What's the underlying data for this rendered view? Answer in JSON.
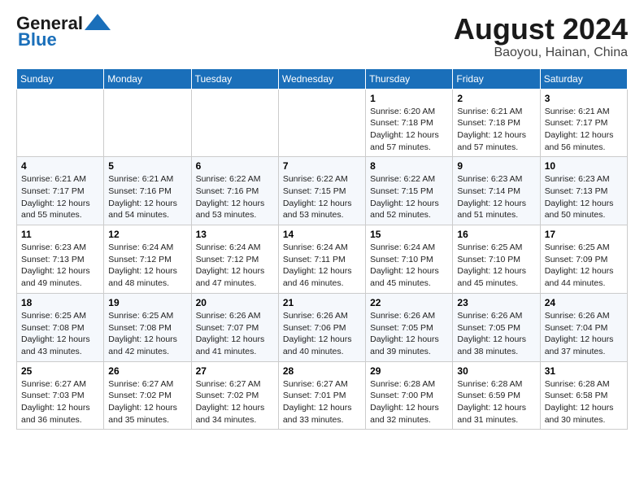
{
  "header": {
    "logo_line1": "General",
    "logo_line2": "Blue",
    "month": "August 2024",
    "location": "Baoyou, Hainan, China"
  },
  "weekdays": [
    "Sunday",
    "Monday",
    "Tuesday",
    "Wednesday",
    "Thursday",
    "Friday",
    "Saturday"
  ],
  "weeks": [
    [
      {
        "day": "",
        "info": ""
      },
      {
        "day": "",
        "info": ""
      },
      {
        "day": "",
        "info": ""
      },
      {
        "day": "",
        "info": ""
      },
      {
        "day": "1",
        "info": "Sunrise: 6:20 AM\nSunset: 7:18 PM\nDaylight: 12 hours\nand 57 minutes."
      },
      {
        "day": "2",
        "info": "Sunrise: 6:21 AM\nSunset: 7:18 PM\nDaylight: 12 hours\nand 57 minutes."
      },
      {
        "day": "3",
        "info": "Sunrise: 6:21 AM\nSunset: 7:17 PM\nDaylight: 12 hours\nand 56 minutes."
      }
    ],
    [
      {
        "day": "4",
        "info": "Sunrise: 6:21 AM\nSunset: 7:17 PM\nDaylight: 12 hours\nand 55 minutes."
      },
      {
        "day": "5",
        "info": "Sunrise: 6:21 AM\nSunset: 7:16 PM\nDaylight: 12 hours\nand 54 minutes."
      },
      {
        "day": "6",
        "info": "Sunrise: 6:22 AM\nSunset: 7:16 PM\nDaylight: 12 hours\nand 53 minutes."
      },
      {
        "day": "7",
        "info": "Sunrise: 6:22 AM\nSunset: 7:15 PM\nDaylight: 12 hours\nand 53 minutes."
      },
      {
        "day": "8",
        "info": "Sunrise: 6:22 AM\nSunset: 7:15 PM\nDaylight: 12 hours\nand 52 minutes."
      },
      {
        "day": "9",
        "info": "Sunrise: 6:23 AM\nSunset: 7:14 PM\nDaylight: 12 hours\nand 51 minutes."
      },
      {
        "day": "10",
        "info": "Sunrise: 6:23 AM\nSunset: 7:13 PM\nDaylight: 12 hours\nand 50 minutes."
      }
    ],
    [
      {
        "day": "11",
        "info": "Sunrise: 6:23 AM\nSunset: 7:13 PM\nDaylight: 12 hours\nand 49 minutes."
      },
      {
        "day": "12",
        "info": "Sunrise: 6:24 AM\nSunset: 7:12 PM\nDaylight: 12 hours\nand 48 minutes."
      },
      {
        "day": "13",
        "info": "Sunrise: 6:24 AM\nSunset: 7:12 PM\nDaylight: 12 hours\nand 47 minutes."
      },
      {
        "day": "14",
        "info": "Sunrise: 6:24 AM\nSunset: 7:11 PM\nDaylight: 12 hours\nand 46 minutes."
      },
      {
        "day": "15",
        "info": "Sunrise: 6:24 AM\nSunset: 7:10 PM\nDaylight: 12 hours\nand 45 minutes."
      },
      {
        "day": "16",
        "info": "Sunrise: 6:25 AM\nSunset: 7:10 PM\nDaylight: 12 hours\nand 45 minutes."
      },
      {
        "day": "17",
        "info": "Sunrise: 6:25 AM\nSunset: 7:09 PM\nDaylight: 12 hours\nand 44 minutes."
      }
    ],
    [
      {
        "day": "18",
        "info": "Sunrise: 6:25 AM\nSunset: 7:08 PM\nDaylight: 12 hours\nand 43 minutes."
      },
      {
        "day": "19",
        "info": "Sunrise: 6:25 AM\nSunset: 7:08 PM\nDaylight: 12 hours\nand 42 minutes."
      },
      {
        "day": "20",
        "info": "Sunrise: 6:26 AM\nSunset: 7:07 PM\nDaylight: 12 hours\nand 41 minutes."
      },
      {
        "day": "21",
        "info": "Sunrise: 6:26 AM\nSunset: 7:06 PM\nDaylight: 12 hours\nand 40 minutes."
      },
      {
        "day": "22",
        "info": "Sunrise: 6:26 AM\nSunset: 7:05 PM\nDaylight: 12 hours\nand 39 minutes."
      },
      {
        "day": "23",
        "info": "Sunrise: 6:26 AM\nSunset: 7:05 PM\nDaylight: 12 hours\nand 38 minutes."
      },
      {
        "day": "24",
        "info": "Sunrise: 6:26 AM\nSunset: 7:04 PM\nDaylight: 12 hours\nand 37 minutes."
      }
    ],
    [
      {
        "day": "25",
        "info": "Sunrise: 6:27 AM\nSunset: 7:03 PM\nDaylight: 12 hours\nand 36 minutes."
      },
      {
        "day": "26",
        "info": "Sunrise: 6:27 AM\nSunset: 7:02 PM\nDaylight: 12 hours\nand 35 minutes."
      },
      {
        "day": "27",
        "info": "Sunrise: 6:27 AM\nSunset: 7:02 PM\nDaylight: 12 hours\nand 34 minutes."
      },
      {
        "day": "28",
        "info": "Sunrise: 6:27 AM\nSunset: 7:01 PM\nDaylight: 12 hours\nand 33 minutes."
      },
      {
        "day": "29",
        "info": "Sunrise: 6:28 AM\nSunset: 7:00 PM\nDaylight: 12 hours\nand 32 minutes."
      },
      {
        "day": "30",
        "info": "Sunrise: 6:28 AM\nSunset: 6:59 PM\nDaylight: 12 hours\nand 31 minutes."
      },
      {
        "day": "31",
        "info": "Sunrise: 6:28 AM\nSunset: 6:58 PM\nDaylight: 12 hours\nand 30 minutes."
      }
    ]
  ]
}
